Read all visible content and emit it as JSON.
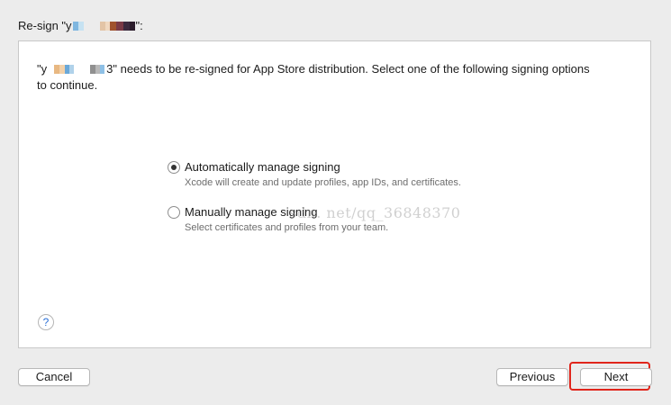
{
  "dialog": {
    "title_prefix": "Re-sign \"y",
    "title_suffix": "\":"
  },
  "message": {
    "line1_prefix": "\"y",
    "line1_fragment": "3",
    "line1_suffix": "\" needs to be re-signed for App Store distribution. Select one of the following signing options",
    "line2": "to continue."
  },
  "options": [
    {
      "label": "Automatically manage signing",
      "description": "Xcode will create and update profiles, app IDs, and certificates.",
      "selected": true
    },
    {
      "label": "Manually manage signing",
      "description": "Select certificates and profiles from your team.",
      "selected": false
    }
  ],
  "watermark": "sdn. net/qq_36848370",
  "help": {
    "label": "?"
  },
  "buttons": {
    "cancel": "Cancel",
    "previous": "Previous",
    "next": "Next"
  },
  "colors": {
    "highlight": "#e0251b",
    "help_accent": "#2a6fd6"
  }
}
